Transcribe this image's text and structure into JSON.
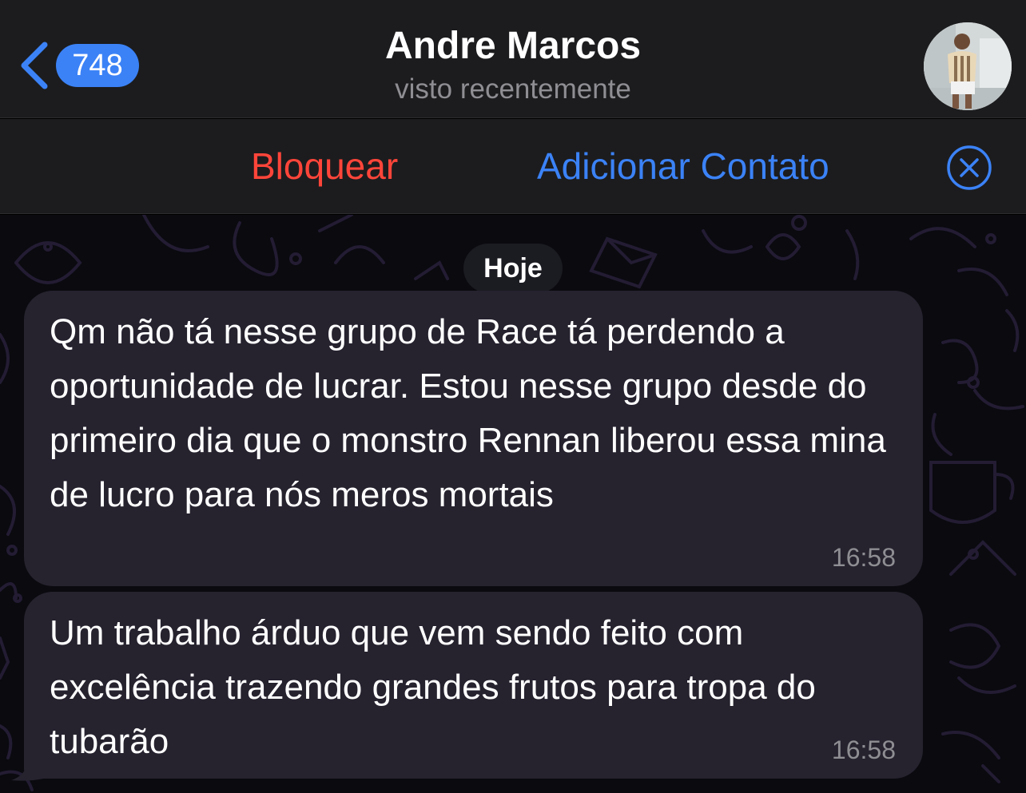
{
  "header": {
    "back_badge": "748",
    "contact_name": "Andre Marcos",
    "contact_status": "visto recentemente"
  },
  "actions": {
    "block_label": "Bloquear",
    "add_contact_label": "Adicionar Contato"
  },
  "chat": {
    "date_separator": "Hoje",
    "messages": [
      {
        "text": "Qm não tá nesse grupo de Race tá perdendo a oportunidade de lucrar. Estou nesse grupo desde do primeiro dia que o monstro Rennan liberou essa mina de lucro para nós meros mortais",
        "time": "16:58"
      },
      {
        "text": "Um trabalho árduo que vem sendo feito com excelência trazendo grandes frutos para tropa do tubarão",
        "time": "16:58"
      }
    ]
  },
  "icons": {
    "back": "chevron-left-icon",
    "close": "close-circle-icon",
    "avatar": "avatar-photo"
  },
  "colors": {
    "accent": "#3b82f6",
    "danger": "#ff453a",
    "bubble": "#26222e",
    "header_bg": "#1c1c1e",
    "secondary_text": "#8e8e93"
  }
}
